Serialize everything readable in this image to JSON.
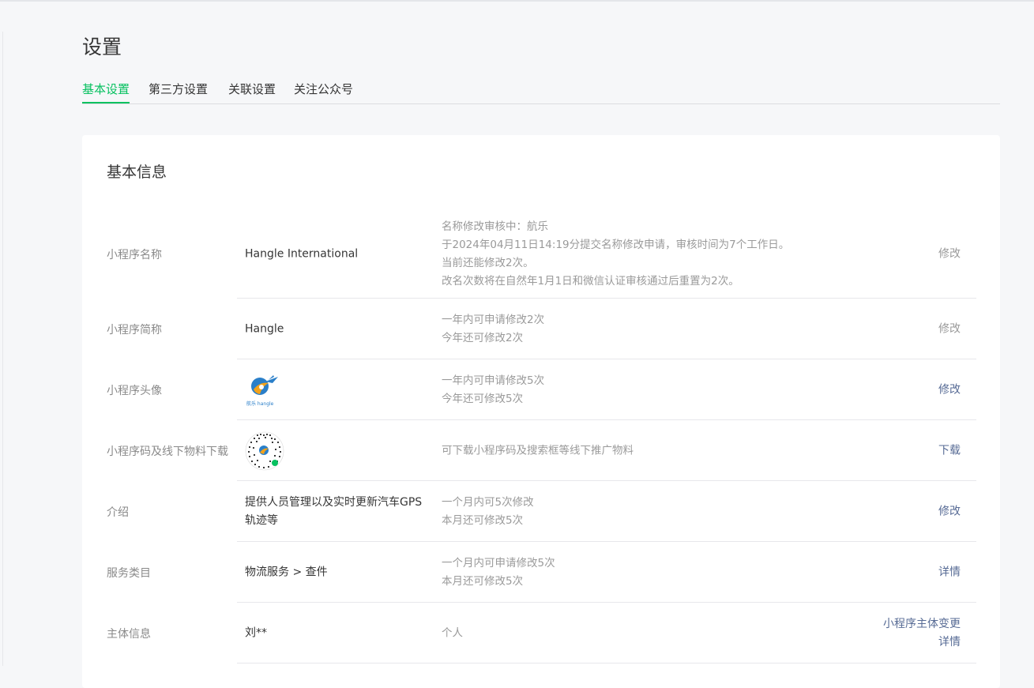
{
  "page": {
    "title": "设置"
  },
  "tabs": [
    {
      "label": "基本设置"
    },
    {
      "label": "第三方设置"
    },
    {
      "label": "关联设置"
    },
    {
      "label": "关注公众号"
    }
  ],
  "card": {
    "title": "基本信息"
  },
  "rows": {
    "name": {
      "label": "小程序名称",
      "value": "Hangle International",
      "desc": [
        "名称修改审核中：航乐",
        "于2024年04月11日14:19分提交名称修改申请，审核时间为7个工作日。",
        "当前还能修改2次。",
        "改名次数将在自然年1月1日和微信认证审核通过后重置为2次。"
      ],
      "action": "修改"
    },
    "short_name": {
      "label": "小程序简称",
      "value": "Hangle",
      "desc": [
        "一年内可申请修改2次",
        "今年还可修改2次"
      ],
      "action": "修改"
    },
    "avatar": {
      "label": "小程序头像",
      "logo_text": "航乐 hangle",
      "desc": [
        "一年内可申请修改5次",
        "今年还可修改5次"
      ],
      "action": "修改"
    },
    "qrcode": {
      "label": "小程序码及线下物料下载",
      "desc": [
        "可下载小程序码及搜索框等线下推广物料"
      ],
      "action": "下载"
    },
    "intro": {
      "label": "介绍",
      "value": "提供人员管理以及实时更新汽车GPS轨迹等",
      "desc": [
        "一个月内可5次修改",
        "本月还可修改5次"
      ],
      "action": "修改"
    },
    "category": {
      "label": "服务类目",
      "value": "物流服务 > 查件",
      "desc": [
        "一个月内可申请修改5次",
        "本月还可修改5次"
      ],
      "action": "详情"
    },
    "subject": {
      "label": "主体信息",
      "value": "刘**",
      "desc": [
        "个人"
      ],
      "action_lines": [
        "小程序主体变更",
        "详情"
      ]
    }
  },
  "colors": {
    "accent": "#07c160",
    "link": "#576b95",
    "muted": "#9a9a9a",
    "background": "#f6f7f9"
  }
}
